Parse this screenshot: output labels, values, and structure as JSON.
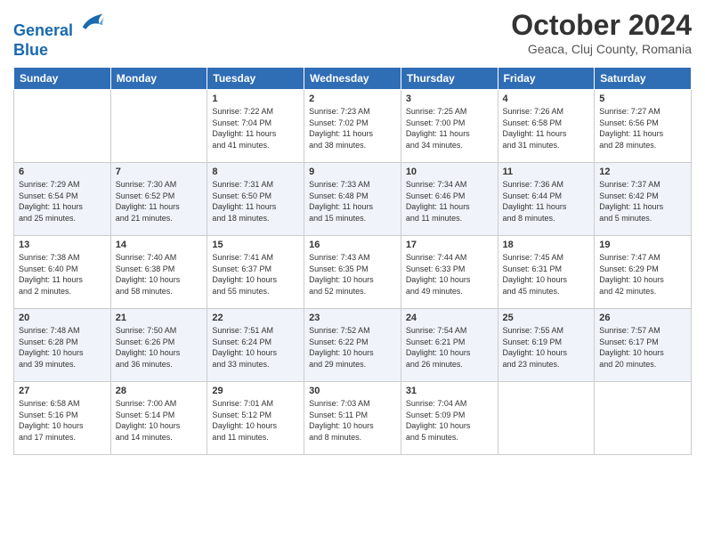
{
  "header": {
    "logo_line1": "General",
    "logo_line2": "Blue",
    "month": "October 2024",
    "location": "Geaca, Cluj County, Romania"
  },
  "weekdays": [
    "Sunday",
    "Monday",
    "Tuesday",
    "Wednesday",
    "Thursday",
    "Friday",
    "Saturday"
  ],
  "weeks": [
    [
      {
        "day": "",
        "content": ""
      },
      {
        "day": "",
        "content": ""
      },
      {
        "day": "1",
        "content": "Sunrise: 7:22 AM\nSunset: 7:04 PM\nDaylight: 11 hours\nand 41 minutes."
      },
      {
        "day": "2",
        "content": "Sunrise: 7:23 AM\nSunset: 7:02 PM\nDaylight: 11 hours\nand 38 minutes."
      },
      {
        "day": "3",
        "content": "Sunrise: 7:25 AM\nSunset: 7:00 PM\nDaylight: 11 hours\nand 34 minutes."
      },
      {
        "day": "4",
        "content": "Sunrise: 7:26 AM\nSunset: 6:58 PM\nDaylight: 11 hours\nand 31 minutes."
      },
      {
        "day": "5",
        "content": "Sunrise: 7:27 AM\nSunset: 6:56 PM\nDaylight: 11 hours\nand 28 minutes."
      }
    ],
    [
      {
        "day": "6",
        "content": "Sunrise: 7:29 AM\nSunset: 6:54 PM\nDaylight: 11 hours\nand 25 minutes."
      },
      {
        "day": "7",
        "content": "Sunrise: 7:30 AM\nSunset: 6:52 PM\nDaylight: 11 hours\nand 21 minutes."
      },
      {
        "day": "8",
        "content": "Sunrise: 7:31 AM\nSunset: 6:50 PM\nDaylight: 11 hours\nand 18 minutes."
      },
      {
        "day": "9",
        "content": "Sunrise: 7:33 AM\nSunset: 6:48 PM\nDaylight: 11 hours\nand 15 minutes."
      },
      {
        "day": "10",
        "content": "Sunrise: 7:34 AM\nSunset: 6:46 PM\nDaylight: 11 hours\nand 11 minutes."
      },
      {
        "day": "11",
        "content": "Sunrise: 7:36 AM\nSunset: 6:44 PM\nDaylight: 11 hours\nand 8 minutes."
      },
      {
        "day": "12",
        "content": "Sunrise: 7:37 AM\nSunset: 6:42 PM\nDaylight: 11 hours\nand 5 minutes."
      }
    ],
    [
      {
        "day": "13",
        "content": "Sunrise: 7:38 AM\nSunset: 6:40 PM\nDaylight: 11 hours\nand 2 minutes."
      },
      {
        "day": "14",
        "content": "Sunrise: 7:40 AM\nSunset: 6:38 PM\nDaylight: 10 hours\nand 58 minutes."
      },
      {
        "day": "15",
        "content": "Sunrise: 7:41 AM\nSunset: 6:37 PM\nDaylight: 10 hours\nand 55 minutes."
      },
      {
        "day": "16",
        "content": "Sunrise: 7:43 AM\nSunset: 6:35 PM\nDaylight: 10 hours\nand 52 minutes."
      },
      {
        "day": "17",
        "content": "Sunrise: 7:44 AM\nSunset: 6:33 PM\nDaylight: 10 hours\nand 49 minutes."
      },
      {
        "day": "18",
        "content": "Sunrise: 7:45 AM\nSunset: 6:31 PM\nDaylight: 10 hours\nand 45 minutes."
      },
      {
        "day": "19",
        "content": "Sunrise: 7:47 AM\nSunset: 6:29 PM\nDaylight: 10 hours\nand 42 minutes."
      }
    ],
    [
      {
        "day": "20",
        "content": "Sunrise: 7:48 AM\nSunset: 6:28 PM\nDaylight: 10 hours\nand 39 minutes."
      },
      {
        "day": "21",
        "content": "Sunrise: 7:50 AM\nSunset: 6:26 PM\nDaylight: 10 hours\nand 36 minutes."
      },
      {
        "day": "22",
        "content": "Sunrise: 7:51 AM\nSunset: 6:24 PM\nDaylight: 10 hours\nand 33 minutes."
      },
      {
        "day": "23",
        "content": "Sunrise: 7:52 AM\nSunset: 6:22 PM\nDaylight: 10 hours\nand 29 minutes."
      },
      {
        "day": "24",
        "content": "Sunrise: 7:54 AM\nSunset: 6:21 PM\nDaylight: 10 hours\nand 26 minutes."
      },
      {
        "day": "25",
        "content": "Sunrise: 7:55 AM\nSunset: 6:19 PM\nDaylight: 10 hours\nand 23 minutes."
      },
      {
        "day": "26",
        "content": "Sunrise: 7:57 AM\nSunset: 6:17 PM\nDaylight: 10 hours\nand 20 minutes."
      }
    ],
    [
      {
        "day": "27",
        "content": "Sunrise: 6:58 AM\nSunset: 5:16 PM\nDaylight: 10 hours\nand 17 minutes."
      },
      {
        "day": "28",
        "content": "Sunrise: 7:00 AM\nSunset: 5:14 PM\nDaylight: 10 hours\nand 14 minutes."
      },
      {
        "day": "29",
        "content": "Sunrise: 7:01 AM\nSunset: 5:12 PM\nDaylight: 10 hours\nand 11 minutes."
      },
      {
        "day": "30",
        "content": "Sunrise: 7:03 AM\nSunset: 5:11 PM\nDaylight: 10 hours\nand 8 minutes."
      },
      {
        "day": "31",
        "content": "Sunrise: 7:04 AM\nSunset: 5:09 PM\nDaylight: 10 hours\nand 5 minutes."
      },
      {
        "day": "",
        "content": ""
      },
      {
        "day": "",
        "content": ""
      }
    ]
  ]
}
